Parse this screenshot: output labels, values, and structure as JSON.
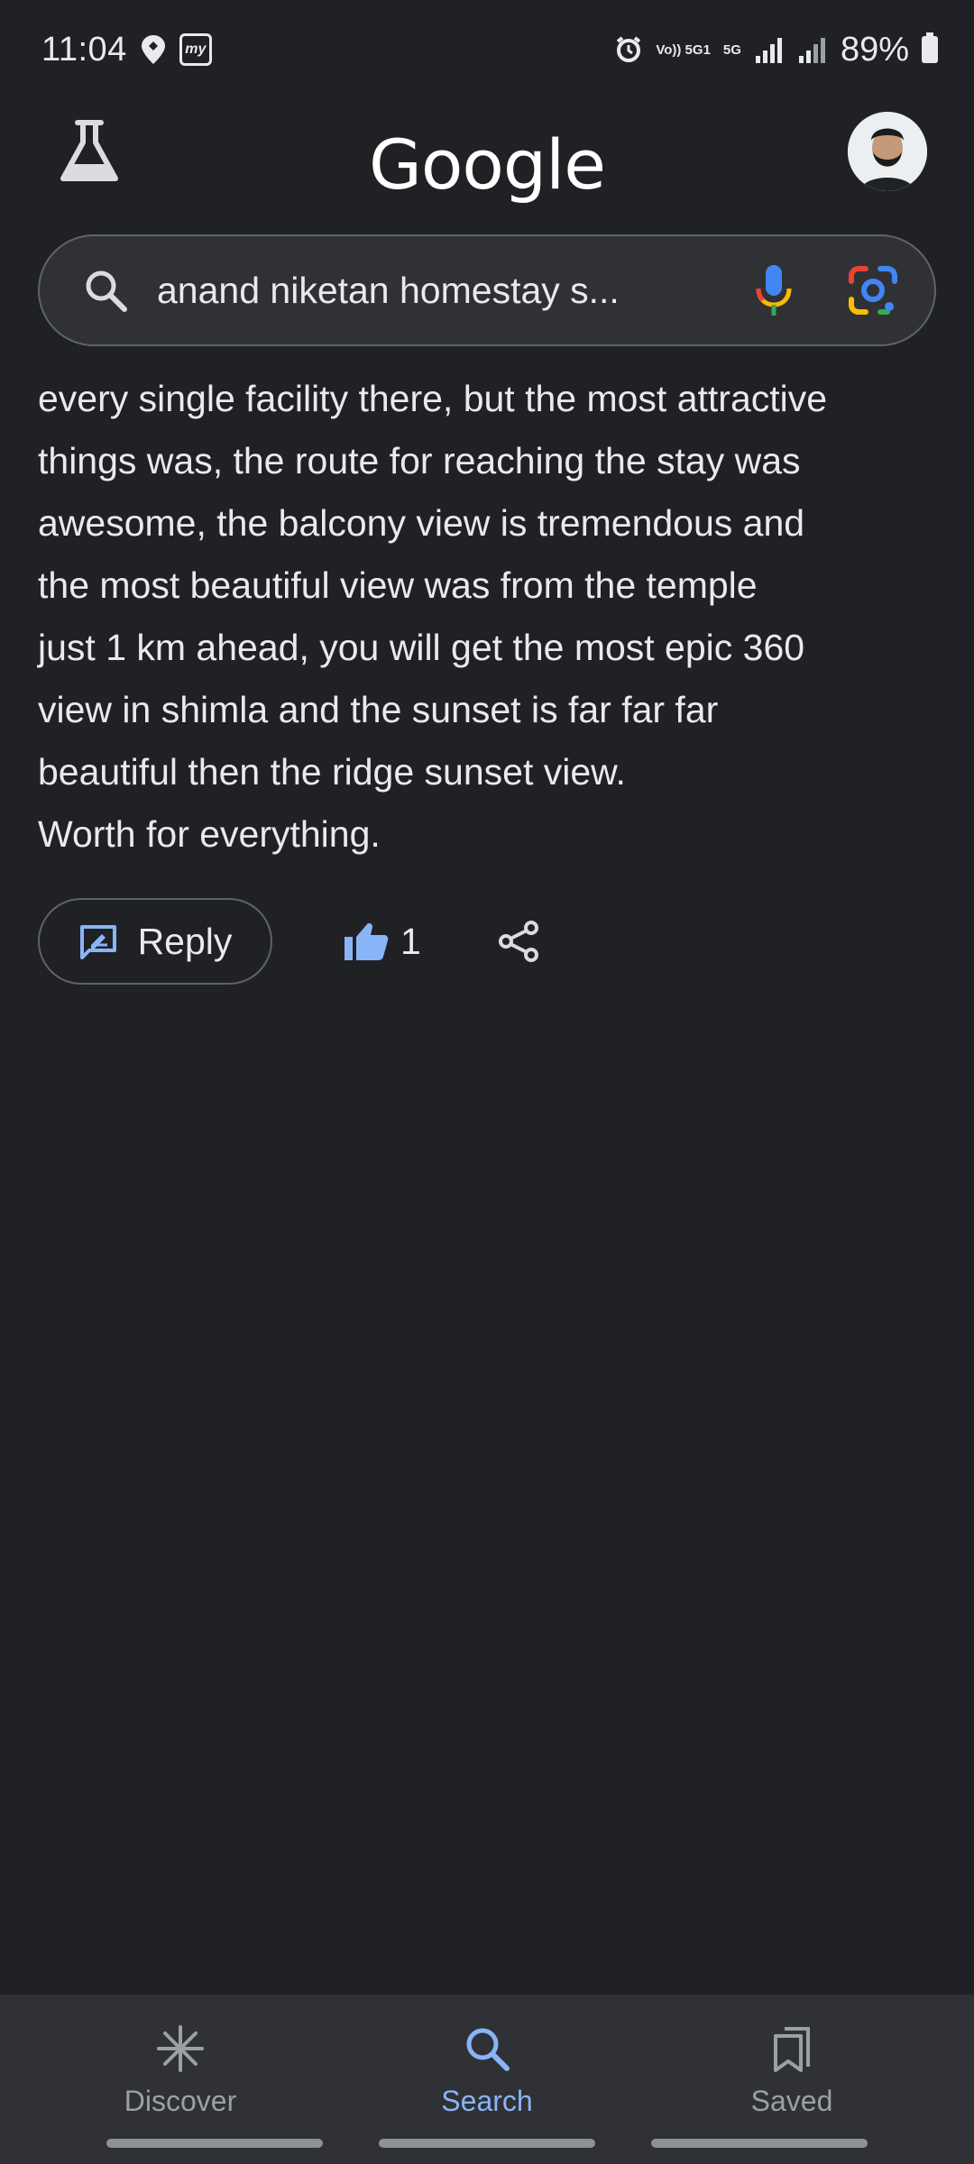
{
  "status_bar": {
    "time": "11:04",
    "app_badge": "my",
    "volte": "Vo)) 5G1",
    "net_type": "5G",
    "battery": "89%"
  },
  "header": {
    "logo": "Google",
    "labs_icon": "flask-icon",
    "avatar_icon": "user-avatar"
  },
  "search": {
    "query": "anand niketan homestay s..."
  },
  "review": {
    "lines": [
      "every single facility there, but the most attractive",
      "things was, the route for reaching the stay was",
      "awesome, the balcony view is tremendous and",
      "the most beautiful view was from the temple",
      "just 1 km ahead, you will get the most epic 360",
      "view in shimla and the sunset is far far far",
      "beautiful then the ridge sunset view.",
      "Worth for everything."
    ]
  },
  "actions": {
    "reply_label": "Reply",
    "like_count": "1"
  },
  "bottom_nav": {
    "items": [
      {
        "label": "Discover",
        "icon": "asterisk-icon"
      },
      {
        "label": "Search",
        "icon": "search-icon"
      },
      {
        "label": "Saved",
        "icon": "bookmarks-icon"
      }
    ],
    "active": "Search"
  },
  "colors": {
    "background": "#202124",
    "surface": "#303134",
    "accent": "#8ab4f8",
    "text": "#e8eaed"
  }
}
